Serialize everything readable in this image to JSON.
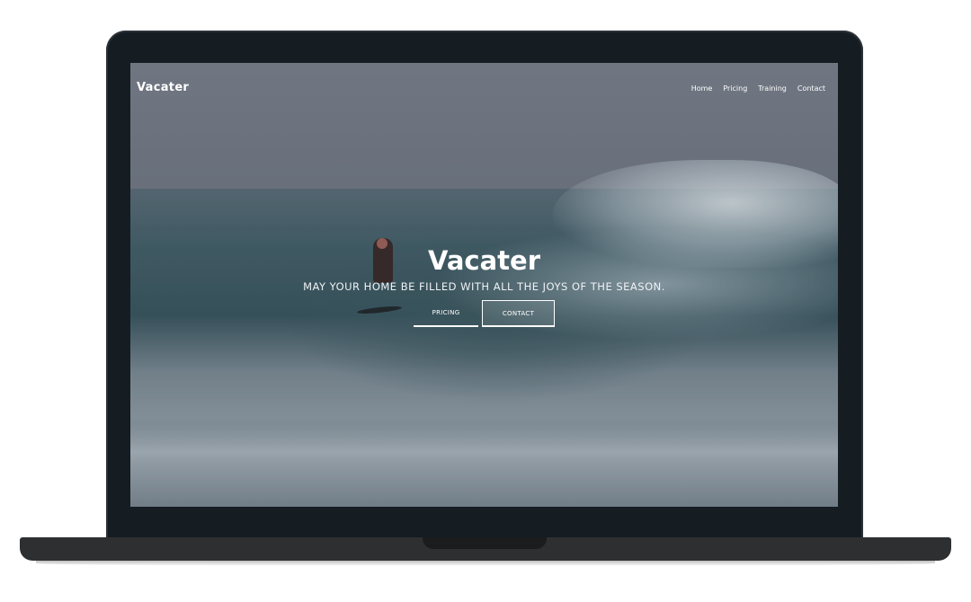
{
  "site": {
    "brand": "Vacater",
    "nav": [
      {
        "label": "Home"
      },
      {
        "label": "Pricing"
      },
      {
        "label": "Training"
      },
      {
        "label": "Contact"
      }
    ]
  },
  "hero": {
    "title": "Vacater",
    "tagline": "MAY YOUR HOME BE FILLED WITH ALL THE JOYS OF THE SEASON.",
    "buttons": {
      "pricing_label": "PRICING",
      "contact_label": "CONTACT"
    }
  },
  "colors": {
    "bezel": "#151c22",
    "base": "#2d2f31",
    "text": "#ffffff"
  }
}
